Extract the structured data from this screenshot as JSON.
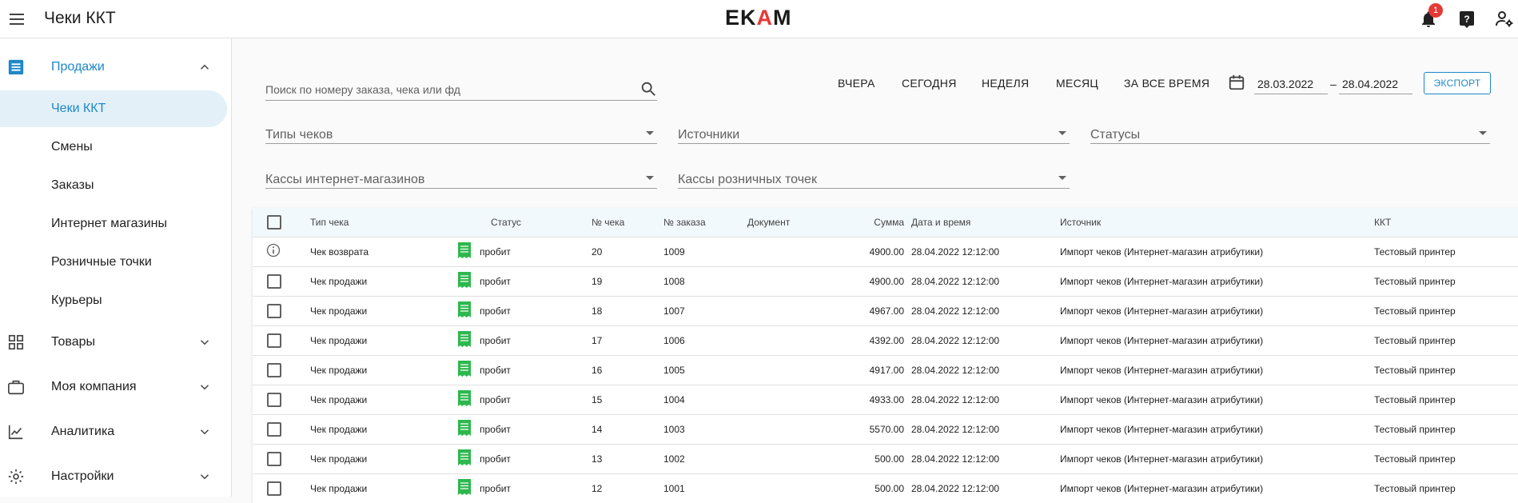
{
  "header": {
    "title": "Чеки ККТ",
    "logo_left": "EK",
    "logo_accent": "A",
    "logo_right": "M",
    "notification_count": "1"
  },
  "sidebar": {
    "sales": "Продажи",
    "sub_items": [
      "Чеки ККТ",
      "Смены",
      "Заказы",
      "Интернет магазины",
      "Розничные точки",
      "Курьеры"
    ],
    "goods": "Товары",
    "company": "Моя компания",
    "analytics": "Аналитика",
    "settings": "Настройки"
  },
  "filters": {
    "search_placeholder": "Поиск по номеру заказа, чека или фд",
    "periods": [
      "ВЧЕРА",
      "СЕГОДНЯ",
      "НЕДЕЛЯ",
      "МЕСЯЦ",
      "ЗА ВСЕ ВРЕМЯ"
    ],
    "date_from": "28.03.2022",
    "date_sep": "–",
    "date_to": "28.04.2022",
    "export": "ЭКСПОРТ",
    "receipt_types": "Типы чеков",
    "sources": "Источники",
    "statuses": "Статусы",
    "online_registers": "Кассы интернет-магазинов",
    "retail_registers": "Кассы розничных точек"
  },
  "table": {
    "columns": [
      "Тип чека",
      "Статус",
      "№ чека",
      "№ заказа",
      "Документ",
      "Сумма",
      "Дата и время",
      "Источник",
      "ККТ"
    ],
    "rows": [
      {
        "type": "Чек возврата",
        "status": "пробит",
        "receipt": "20",
        "order": "1009",
        "doc": "",
        "sum": "4900.00",
        "date": "28.04.2022 12:12:00",
        "source": "Импорт чеков (Интернет-магазин атрибутики)",
        "kkt": "Тестовый принтер"
      },
      {
        "type": "Чек продажи",
        "status": "пробит",
        "receipt": "19",
        "order": "1008",
        "doc": "",
        "sum": "4900.00",
        "date": "28.04.2022 12:12:00",
        "source": "Импорт чеков (Интернет-магазин атрибутики)",
        "kkt": "Тестовый принтер"
      },
      {
        "type": "Чек продажи",
        "status": "пробит",
        "receipt": "18",
        "order": "1007",
        "doc": "",
        "sum": "4967.00",
        "date": "28.04.2022 12:12:00",
        "source": "Импорт чеков (Интернет-магазин атрибутики)",
        "kkt": "Тестовый принтер"
      },
      {
        "type": "Чек продажи",
        "status": "пробит",
        "receipt": "17",
        "order": "1006",
        "doc": "",
        "sum": "4392.00",
        "date": "28.04.2022 12:12:00",
        "source": "Импорт чеков (Интернет-магазин атрибутики)",
        "kkt": "Тестовый принтер"
      },
      {
        "type": "Чек продажи",
        "status": "пробит",
        "receipt": "16",
        "order": "1005",
        "doc": "",
        "sum": "4917.00",
        "date": "28.04.2022 12:12:00",
        "source": "Импорт чеков (Интернет-магазин атрибутики)",
        "kkt": "Тестовый принтер"
      },
      {
        "type": "Чек продажи",
        "status": "пробит",
        "receipt": "15",
        "order": "1004",
        "doc": "",
        "sum": "4933.00",
        "date": "28.04.2022 12:12:00",
        "source": "Импорт чеков (Интернет-магазин атрибутики)",
        "kkt": "Тестовый принтер"
      },
      {
        "type": "Чек продажи",
        "status": "пробит",
        "receipt": "14",
        "order": "1003",
        "doc": "",
        "sum": "5570.00",
        "date": "28.04.2022 12:12:00",
        "source": "Импорт чеков (Интернет-магазин атрибутики)",
        "kkt": "Тестовый принтер"
      },
      {
        "type": "Чек продажи",
        "status": "пробит",
        "receipt": "13",
        "order": "1002",
        "doc": "",
        "sum": "500.00",
        "date": "28.04.2022 12:12:00",
        "source": "Импорт чеков (Интернет-магазин атрибутики)",
        "kkt": "Тестовый принтер"
      },
      {
        "type": "Чек продажи",
        "status": "пробит",
        "receipt": "12",
        "order": "1001",
        "doc": "",
        "sum": "500.00",
        "date": "28.04.2022 12:12:00",
        "source": "Импорт чеков (Интернет-магазин атрибутики)",
        "kkt": "Тестовый принтер"
      }
    ]
  },
  "colors": {
    "accent": "#1e88c8",
    "status_green": "#2db84d",
    "badge": "#e53935"
  },
  "icons": {
    "menu": "menu-icon",
    "bell": "bell-icon",
    "help": "help-icon",
    "account": "account-settings-icon",
    "search": "search-icon",
    "calendar": "calendar-icon",
    "info": "info-icon",
    "receipt": "receipt-icon"
  }
}
